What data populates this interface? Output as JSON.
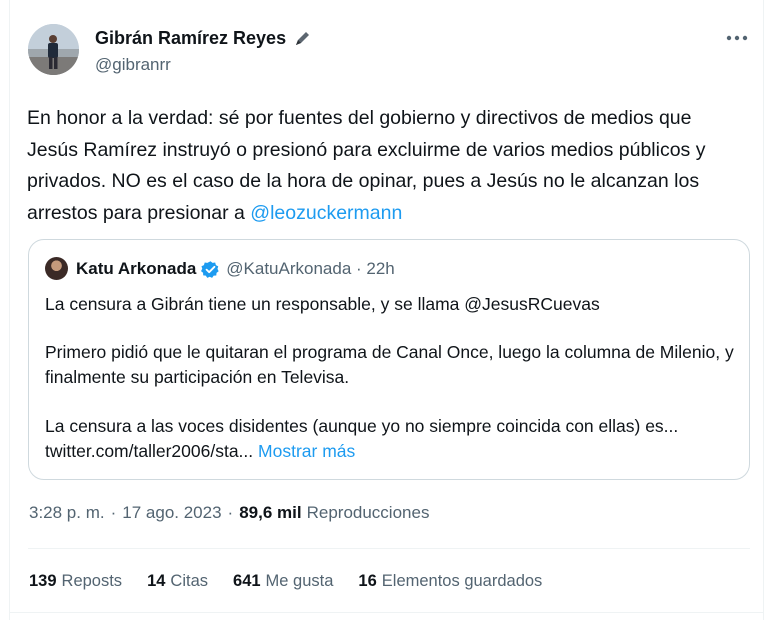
{
  "author": {
    "name": "Gibrán Ramírez Reyes",
    "handle": "@gibranrr"
  },
  "tweet": {
    "text_prefix": "En honor a la verdad: sé por fuentes del gobierno y directivos de medios que Jesús Ramírez instruyó o presionó para excluirme de varios medios públicos y privados. NO es el caso de la hora de opinar, pues a Jesús no le alcanzan los arrestos para presionar a ",
    "mention": "@leozuckermann"
  },
  "quote": {
    "name": "Katu Arkonada",
    "handle_time": "@KatuArkonada · 22h",
    "paragraph1": "La censura a Gibrán tiene un responsable, y se llama @JesusRCuevas",
    "paragraph2": "Primero pidió que le quitaran el programa de Canal Once, luego la columna de Milenio, y finalmente su participación en Televisa.",
    "paragraph3": "La censura a las voces disidentes (aunque yo no siempre coincida con ellas) es... twitter.com/taller2006/sta...",
    "show_more": "Mostrar más"
  },
  "meta": {
    "time": "3:28 p. m.",
    "separator1": "·",
    "date": "17 ago. 2023",
    "separator2": "·",
    "views_count": "89,6 mil",
    "views_label": "Reproducciones"
  },
  "stats": [
    {
      "count": "139",
      "label": "Reposts"
    },
    {
      "count": "14",
      "label": "Citas"
    },
    {
      "count": "641",
      "label": "Me gusta"
    },
    {
      "count": "16",
      "label": "Elementos guardados"
    }
  ],
  "icons": {
    "more": "more-horizontal-icon",
    "pen": "pen-icon",
    "verified": "verified-badge-icon"
  },
  "colors": {
    "link": "#1d9bf0",
    "text": "#0f1419",
    "secondary": "#536471",
    "border": "#cfd9de"
  }
}
